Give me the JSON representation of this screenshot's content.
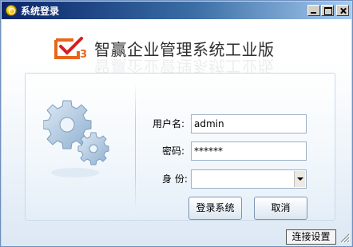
{
  "window": {
    "title": "系统登录"
  },
  "header": {
    "product_name": "智赢企业管理系统工业版"
  },
  "form": {
    "username_label": "用户名:",
    "username_value": "admin",
    "password_label": "密码:",
    "password_value": "******",
    "role_label": "身 份:",
    "role_value": ""
  },
  "buttons": {
    "login": "登录系统",
    "cancel": "取消",
    "connection_settings": "连接设置"
  },
  "icons": {
    "app": "app-icon",
    "logo": "logo-icon",
    "gears": "gears-icon"
  },
  "colors": {
    "title_bar_start": "#0a246a",
    "title_bar_end": "#a6caf0",
    "logo_orange": "#e8661c",
    "logo_check": "#d81e1e",
    "gear_blue": "#a9c3dd"
  }
}
